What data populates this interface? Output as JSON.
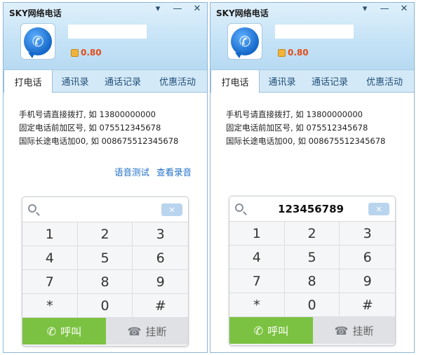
{
  "windows": [
    {
      "title": "SKY网络电话",
      "window_controls": [
        "▾",
        "—",
        "✕"
      ],
      "balance": "0.80",
      "tabs": [
        "打电话",
        "通讯录",
        "通话记录",
        "优惠活动"
      ],
      "instructions": [
        "手机号请直接拨打, 如 13800000000",
        "固定电话前加区号, 如 075512345678",
        "国际长途电话加00, 如 008675512345678"
      ],
      "links": [
        "语音测试",
        "查看录音"
      ],
      "number_value": "",
      "keys": [
        "1",
        "2",
        "3",
        "4",
        "5",
        "6",
        "7",
        "8",
        "9",
        "*",
        "0",
        "#"
      ],
      "backspace_label": "✕",
      "call_label": "呼叫",
      "hangup_label": "挂断"
    },
    {
      "title": "SKY网络电话",
      "window_controls": [
        "▾",
        "—",
        "✕"
      ],
      "balance": "0.80",
      "tabs": [
        "打电话",
        "通讯录",
        "通话记录",
        "优惠活动"
      ],
      "instructions": [
        "手机号请直接拨打, 如 13800000000",
        "固定电话前加区号, 如 075512345678",
        "国际长途电话加00, 如 008675512345678"
      ],
      "number_value": "123456789",
      "keys": [
        "1",
        "2",
        "3",
        "4",
        "5",
        "6",
        "7",
        "8",
        "9",
        "*",
        "0",
        "#"
      ],
      "backspace_label": "✕",
      "call_label": "呼叫",
      "hangup_label": "挂断"
    }
  ],
  "colors": {
    "balance": "#e44b16",
    "link": "#1e6ec8",
    "call_button": "#7cc242",
    "hangup_button": "#dfe1e4"
  },
  "icons": {
    "avatar": "phone-chat-icon",
    "search": "search-icon",
    "backspace": "backspace-icon",
    "call": "phone-icon",
    "hangup": "hangup-icon",
    "coin": "coin-icon"
  }
}
